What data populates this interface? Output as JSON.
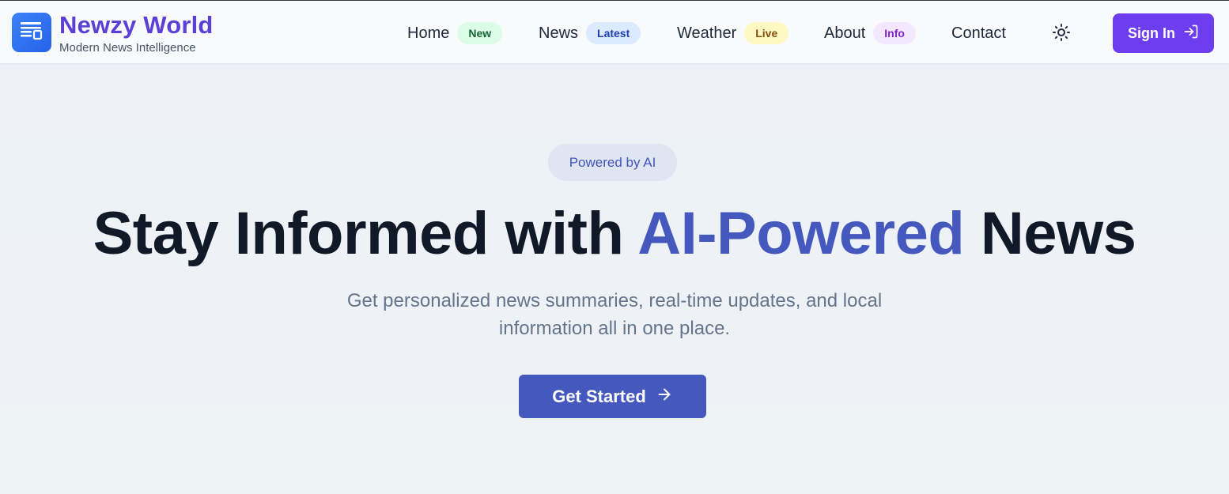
{
  "header": {
    "brand": {
      "title": "Newzy World",
      "subtitle": "Modern News Intelligence",
      "icon": "newspaper-icon"
    },
    "nav": [
      {
        "label": "Home",
        "badge": "New",
        "badge_color": "#dcfce7"
      },
      {
        "label": "News",
        "badge": "Latest",
        "badge_color": "#dbeafe"
      },
      {
        "label": "Weather",
        "badge": "Live",
        "badge_color": "#fef9c3"
      },
      {
        "label": "About",
        "badge": "Info",
        "badge_color": "#f3e8ff"
      },
      {
        "label": "Contact"
      }
    ],
    "theme_toggle_icon": "sun-icon",
    "sign_in_label": "Sign In",
    "sign_in_icon": "sign-in-icon"
  },
  "hero": {
    "pill": "Powered by AI",
    "headline_part1": "Stay Informed with ",
    "headline_accent": "AI-Powered",
    "headline_part2": " News",
    "subtitle": "Get personalized news summaries, real-time updates, and local information all in one place.",
    "cta_label": "Get Started",
    "cta_icon": "arrow-right-icon"
  },
  "colors": {
    "brand": "#5b3fd6",
    "accent": "#4458bd",
    "sign_in_bg": "#6d3ef0",
    "headline": "#111827"
  }
}
